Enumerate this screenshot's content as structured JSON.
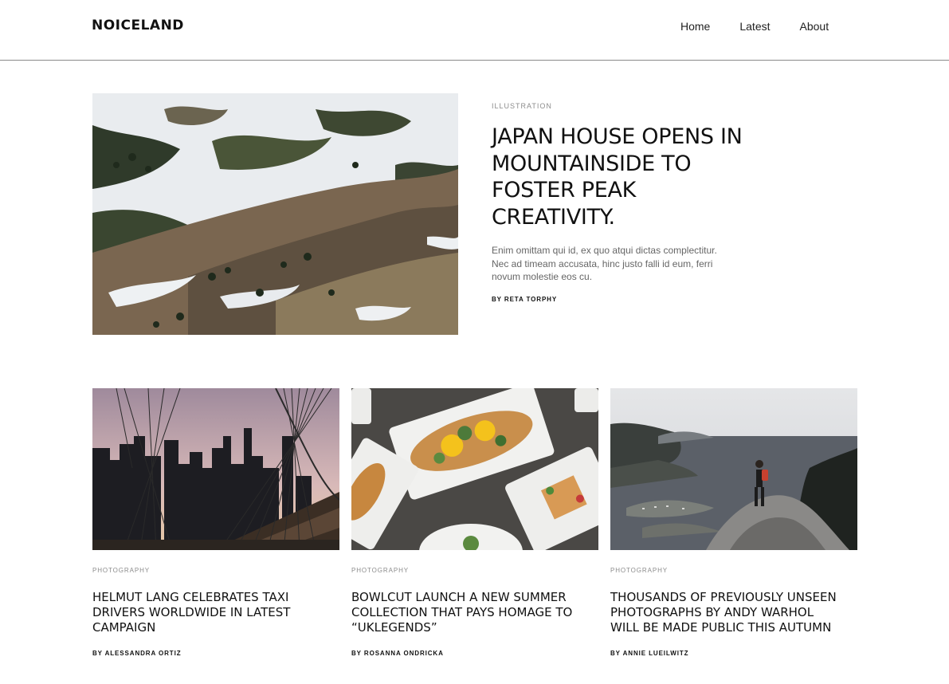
{
  "header": {
    "logo": "NOICELAND",
    "nav": [
      "Home",
      "Latest",
      "About"
    ]
  },
  "hero": {
    "category": "ILLUSTRATION",
    "title": "JAPAN HOUSE OPENS IN MOUNTAINSIDE TO FOSTER PEAK CREATIVITY.",
    "excerpt": "Enim omittam qui id, ex quo atqui dictas complectitur. Nec ad timeam accusata, hinc justo falli id eum, ferri novum molestie eos cu.",
    "byline": "BY RETA TORPHY"
  },
  "cards": [
    {
      "category": "PHOTOGRAPHY",
      "title": "HELMUT LANG CELEBRATES TAXI DRIVERS WORLDWIDE IN LATEST CAMPAIGN",
      "byline": "BY ALESSANDRA ORTIZ"
    },
    {
      "category": "PHOTOGRAPHY",
      "title": "BOWLCUT LAUNCH A NEW SUMMER COLLECTION THAT PAYS HOMAGE TO “UKLEGENDS”",
      "byline": "BY ROSANNA ONDRICKA"
    },
    {
      "category": "PHOTOGRAPHY",
      "title": "THOUSANDS OF PREVIOUSLY UNSEEN PHOTOGRAPHS BY ANDY WARHOL WILL BE MADE PUBLIC THIS AUTUMN",
      "byline": "BY ANNIE LUEILWITZ"
    }
  ]
}
